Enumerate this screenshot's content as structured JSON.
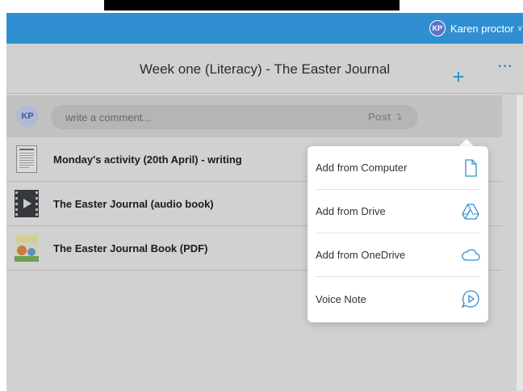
{
  "header": {
    "user_initials": "KP",
    "user_name": "Karen proctor",
    "chevron_icon": "chevron-down-icon"
  },
  "assignment": {
    "title": "Week one (Literacy) - The Easter Journal",
    "more_label": "···"
  },
  "comment": {
    "avatar_initials": "KP",
    "placeholder": "write a comment...",
    "post_label": "Post",
    "post_icon": "↴"
  },
  "add_button": {
    "label": "+"
  },
  "attachments": [
    {
      "title": "Monday's activity (20th April) - writing",
      "icon": "document-thumbnail"
    },
    {
      "title": "The Easter Journal (audio book)",
      "icon": "video-thumbnail"
    },
    {
      "title": "The Easter Journal Book (PDF)",
      "icon": "book-cover-thumbnail"
    }
  ],
  "add_menu": {
    "items": [
      {
        "label": "Add from Computer",
        "icon": "file-icon"
      },
      {
        "label": "Add from Drive",
        "icon": "google-drive-icon"
      },
      {
        "label": "Add from OneDrive",
        "icon": "cloud-icon"
      },
      {
        "label": "Voice Note",
        "icon": "voice-note-icon"
      }
    ]
  },
  "colors": {
    "brand_blue": "#2f8fd0",
    "overlay_gray": "#eeeeee"
  }
}
